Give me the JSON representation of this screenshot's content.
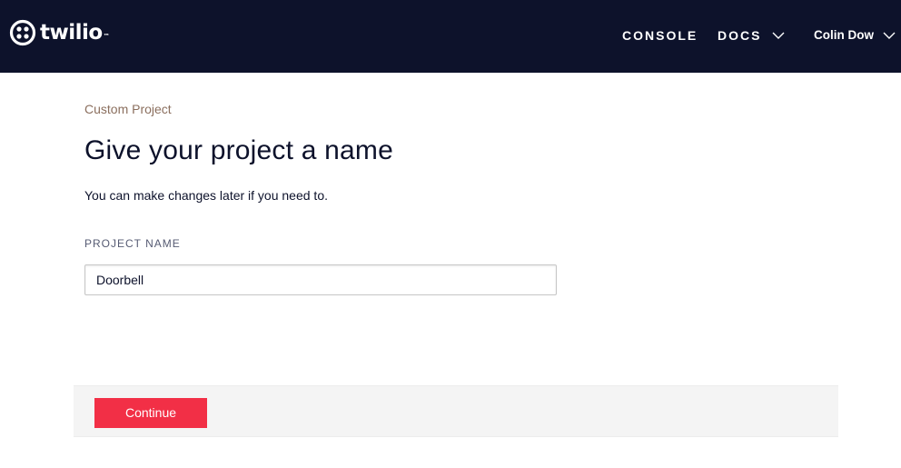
{
  "header": {
    "brand": "twilio",
    "brand_mark": "™",
    "nav": {
      "console": "CONSOLE",
      "docs": "DOCS",
      "user": "Colin Dow"
    },
    "icons": {
      "logo": "twilio-logo-icon",
      "dropdown": "chevron-down-icon"
    }
  },
  "main": {
    "breadcrumb": "Custom Project",
    "title": "Give your project a name",
    "subtitle": "You can make changes later if you need to.",
    "project_name": {
      "label": "PROJECT NAME",
      "value": "Doorbell"
    }
  },
  "footer": {
    "continue_label": "Continue"
  },
  "colors": {
    "topbar": "#0d122b",
    "accent": "#f22f46",
    "breadcrumb": "#8b6f5e"
  }
}
